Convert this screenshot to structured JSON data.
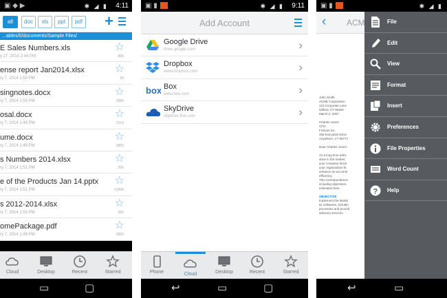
{
  "status": {
    "time_left": "4:11",
    "time_middle": "9:11"
  },
  "files_screen": {
    "filter_tabs": [
      {
        "label": "all",
        "active": true
      },
      {
        "label": "doc",
        "active": false
      },
      {
        "label": "xls",
        "active": false
      },
      {
        "label": "ppt",
        "active": false
      },
      {
        "label": "pdf",
        "active": false
      }
    ],
    "path": "...ables/0/documents/Sample Files/",
    "files": [
      {
        "name": "E Sales Numbers.xls",
        "date": "y 27, 2014 2:44 PM",
        "size": "885"
      },
      {
        "name": "ense report Jan2014.xlsx",
        "date": "ry 7, 2014 1:50 PM",
        "size": "99"
      },
      {
        "name": "singnotes.docx",
        "date": "ry 7, 2014 1:50 PM",
        "size": "2986"
      },
      {
        "name": "osal.docx",
        "date": "ry 7, 2014 1:49 PM",
        "size": "2319"
      },
      {
        "name": "ume.docx",
        "date": "ry 7, 2014 1:49 PM",
        "size": "5865"
      },
      {
        "name": "s Numbers 2014.xlsx",
        "date": "ry 7, 2014 1:51 PM",
        "size": "556"
      },
      {
        "name": "e of the Products Jan 14.pptx",
        "date": "ry 7, 2014 1:51 PM",
        "size": "13499"
      },
      {
        "name": "s 2012-2014.xlsx",
        "date": "ry 7, 2014 1:52 PM",
        "size": "556"
      },
      {
        "name": "omePackage.pdf",
        "date": "ry 7, 2014 1:49 PM",
        "size": "5865"
      }
    ],
    "tabs": [
      {
        "label": "Cloud",
        "icon": "cloud-icon"
      },
      {
        "label": "Desktop",
        "icon": "monitor-icon"
      },
      {
        "label": "Recent",
        "icon": "clock-icon"
      },
      {
        "label": "Starred",
        "icon": "star-icon"
      }
    ]
  },
  "add_account_screen": {
    "title": "Add Account",
    "accounts": [
      {
        "name": "Google Drive",
        "sub": "drive.google.com",
        "icon": "google-drive-icon"
      },
      {
        "name": "Dropbox",
        "sub": "www.dropbox.com",
        "icon": "dropbox-icon"
      },
      {
        "name": "Box",
        "sub": "www.box.com",
        "icon": "box-icon"
      },
      {
        "name": "SkyDrive",
        "sub": "skydrive.live.com",
        "icon": "skydrive-icon"
      }
    ],
    "tabs": [
      {
        "label": "Phone",
        "icon": "phone-icon",
        "active": false
      },
      {
        "label": "Cloud",
        "icon": "cloud-icon",
        "active": true
      },
      {
        "label": "Desktop",
        "icon": "monitor-icon",
        "active": false
      },
      {
        "label": "Recent",
        "icon": "clock-icon",
        "active": false
      },
      {
        "label": "Starred",
        "icon": "star-icon",
        "active": false
      }
    ]
  },
  "document_screen": {
    "title": "ACM",
    "doc_lines": [
      {
        "text": "John Smith"
      },
      {
        "text": "ACME Corporation"
      },
      {
        "text": "123 Corporate Lane"
      },
      {
        "text": "Milford, CT 06460"
      },
      {
        "text": "March 2, 2007"
      },
      {
        "text": ""
      },
      {
        "text": "Charles Jones"
      },
      {
        "text": "CFO"
      },
      {
        "text": "Fictious Inc."
      },
      {
        "text": "456 Executive Drive"
      },
      {
        "text": "Anywhere, CT 06777"
      },
      {
        "text": ""
      },
      {
        "text": "Dear Charles Jones:"
      },
      {
        "text": ""
      },
      {
        "text": "As a long time admi"
      },
      {
        "text": "done in the market,"
      },
      {
        "text": "your company functi"
      },
      {
        "text": "your organization fa"
      },
      {
        "text": "enhance its accounti"
      },
      {
        "text": "efficiency."
      },
      {
        "text": "This correspondence"
      },
      {
        "text": "including objectives,"
      },
      {
        "text": "estimated fees."
      },
      {
        "text": ""
      },
      {
        "text": "OBJECTIVE",
        "blue": true
      },
      {
        "text": "Implement the Model"
      },
      {
        "text": "ID softwares, includin"
      },
      {
        "text": "processes and proced"
      },
      {
        "text": "advisory services."
      }
    ],
    "menu": [
      {
        "label": "File",
        "icon": "file-icon"
      },
      {
        "label": "Edit",
        "icon": "pencil-icon"
      },
      {
        "label": "View",
        "icon": "magnifier-icon"
      },
      {
        "label": "Format",
        "icon": "format-icon"
      },
      {
        "label": "Insert",
        "icon": "insert-icon"
      },
      {
        "label": "Preferences",
        "icon": "gear-icon"
      },
      {
        "label": "File Properties",
        "icon": "info-icon"
      },
      {
        "label": "Word Count",
        "icon": "word-count-icon"
      },
      {
        "label": "Help",
        "icon": "help-icon"
      }
    ]
  },
  "colors": {
    "accent": "#1c8fd8",
    "menu_bg": "#575b5f",
    "tab_bar": "#e9eaeb"
  }
}
